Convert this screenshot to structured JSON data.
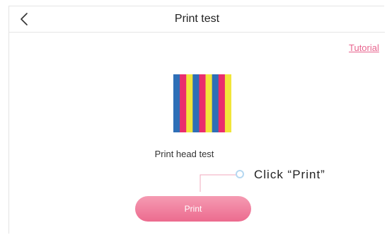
{
  "header": {
    "title": "Print test",
    "back_icon": "chevron-left-icon"
  },
  "tutorial": {
    "label": "Tutorial"
  },
  "test_pattern": {
    "stripe_colors": [
      "#2e6fb7",
      "#ea2d6d",
      "#f2e53a",
      "#2e6fb7",
      "#ea2d6d",
      "#f2e53a",
      "#2e6fb7",
      "#ea2d6d",
      "#f2e53a"
    ]
  },
  "caption": "Print head test",
  "callout": {
    "text": "Click “Print”"
  },
  "print_button": {
    "label": "Print"
  },
  "colors": {
    "accent": "#e8648e",
    "button_top": "#f59bb3",
    "button_bottom": "#ec6b8f"
  }
}
